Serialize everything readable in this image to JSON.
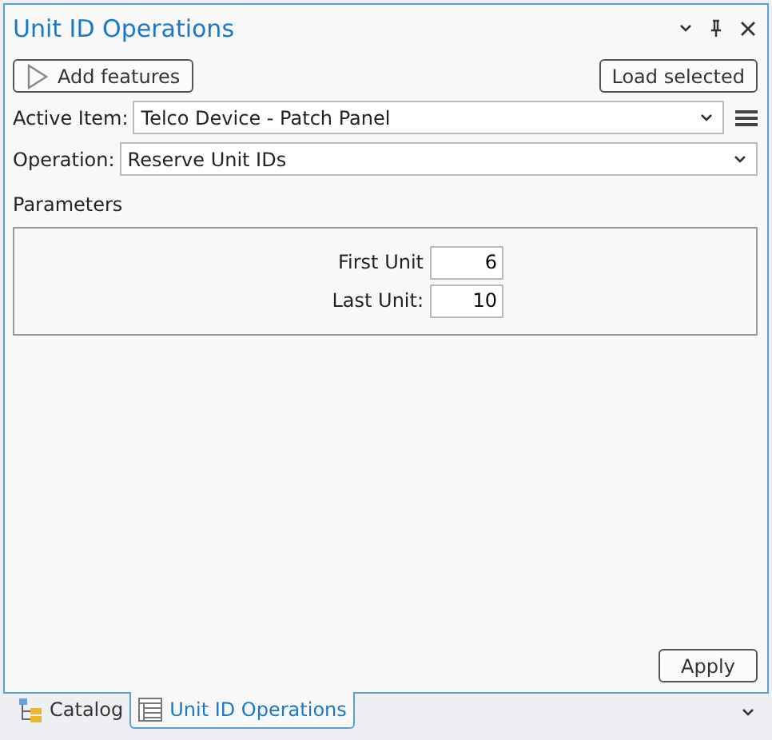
{
  "window": {
    "title": "Unit ID Operations"
  },
  "toolbar": {
    "add_button": "Add features",
    "load_button": "Load selected"
  },
  "active_item": {
    "label": "Active Item:",
    "value": "Telco Device - Patch Panel"
  },
  "operation": {
    "label": "Operation:",
    "value": "Reserve Unit IDs"
  },
  "parameters": {
    "title": "Parameters",
    "fields": [
      {
        "label": "First Unit",
        "value": "6"
      },
      {
        "label": "Last Unit:",
        "value": "10"
      }
    ]
  },
  "apply_button": "Apply",
  "tabs": [
    {
      "label": "Catalog",
      "kind": "catalog",
      "selected": false
    },
    {
      "label": "Unit ID Operations",
      "kind": "table",
      "selected": true
    }
  ]
}
